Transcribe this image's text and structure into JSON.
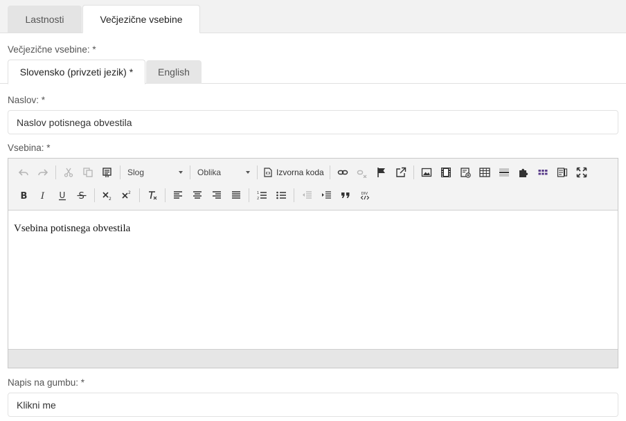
{
  "tabs": [
    {
      "label": "Lastnosti",
      "active": false
    },
    {
      "label": "Večjezične vsebine",
      "active": true
    }
  ],
  "multilang_label": "Večjezične vsebine: *",
  "lang_tabs": [
    {
      "label": "Slovensko (privzeti jezik) *",
      "active": true
    },
    {
      "label": "English",
      "active": false
    }
  ],
  "title_field": {
    "label": "Naslov: *",
    "value": "Naslov potisnega obvestila"
  },
  "content_field": {
    "label": "Vsebina: *",
    "toolbar": {
      "style_combo": "Slog",
      "format_combo": "Oblika",
      "source_label": "Izvorna koda"
    },
    "body_text": "Vsebina potisnega obvestila"
  },
  "button_field": {
    "label": "Napis na gumbu: *",
    "value": "Klikni me"
  },
  "colors": {
    "tab_bg": "#f2f2f2",
    "border": "#e0e0e0",
    "toolbar_bg": "#f3f3f3"
  }
}
